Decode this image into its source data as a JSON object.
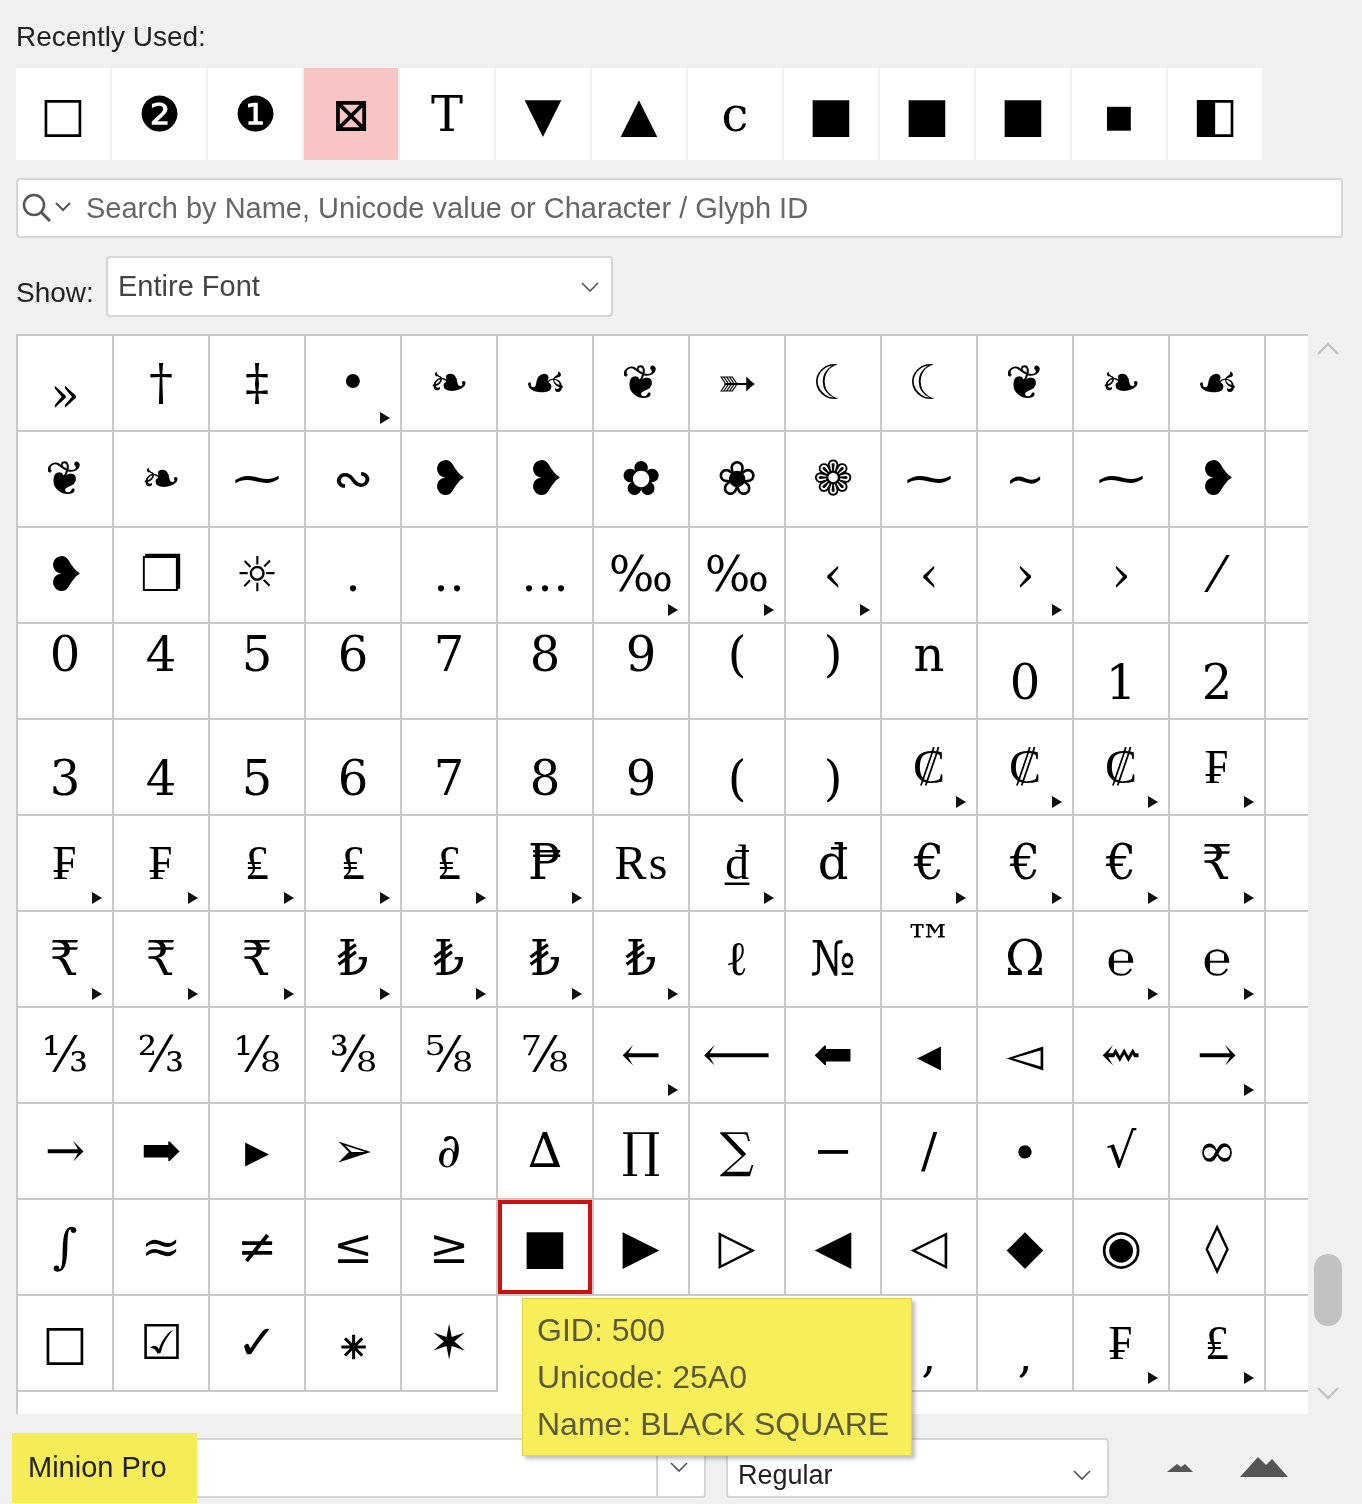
{
  "recent": {
    "label": "Recently Used:",
    "glyphs": [
      {
        "glyph": "□",
        "selected": false
      },
      {
        "glyph": "❷",
        "selected": false
      },
      {
        "glyph": "❶",
        "selected": false
      },
      {
        "glyph": "⊠",
        "selected": true
      },
      {
        "glyph": "T",
        "selected": false
      },
      {
        "glyph": "▼",
        "selected": false
      },
      {
        "glyph": "▲",
        "selected": false
      },
      {
        "glyph": "c",
        "selected": false
      },
      {
        "glyph": "■",
        "selected": false
      },
      {
        "glyph": "■",
        "selected": false
      },
      {
        "glyph": "■",
        "selected": false
      },
      {
        "glyph": "▪",
        "selected": false
      },
      {
        "glyph": "◧",
        "selected": false
      }
    ]
  },
  "search": {
    "placeholder": "Search by Name, Unicode value or Character / Glyph ID"
  },
  "show": {
    "label": "Show:",
    "value": "Entire Font"
  },
  "grid": [
    [
      {
        "kind": "inferior",
        "glyph": "»",
        "alternates": false
      },
      {
        "kind": "glyph",
        "glyph": "†",
        "alternates": false
      },
      {
        "kind": "glyph",
        "glyph": "‡",
        "alternates": false
      },
      {
        "kind": "glyph",
        "glyph": "•",
        "alternates": true
      },
      {
        "kind": "glyph",
        "glyph": "❧",
        "alternates": false
      },
      {
        "kind": "glyph",
        "glyph": "☙",
        "alternates": false
      },
      {
        "kind": "glyph",
        "glyph": "❦",
        "alternates": false
      },
      {
        "kind": "glyph",
        "glyph": "➳",
        "alternates": false
      },
      {
        "kind": "glyph",
        "glyph": "☾",
        "alternates": false
      },
      {
        "kind": "glyph",
        "glyph": "☾",
        "alternates": false
      },
      {
        "kind": "glyph",
        "glyph": "❦",
        "alternates": false
      },
      {
        "kind": "glyph",
        "glyph": "❧",
        "alternates": false
      },
      {
        "kind": "glyph",
        "glyph": "☙",
        "alternates": false
      }
    ],
    [
      {
        "kind": "glyph",
        "glyph": "❦",
        "alternates": false
      },
      {
        "kind": "glyph",
        "glyph": "❧",
        "alternates": false
      },
      {
        "kind": "glyph",
        "glyph": "⁓",
        "alternates": false
      },
      {
        "kind": "glyph",
        "glyph": "∾",
        "alternates": false
      },
      {
        "kind": "glyph",
        "glyph": "❥",
        "alternates": false
      },
      {
        "kind": "glyph",
        "glyph": "❥",
        "alternates": false
      },
      {
        "kind": "glyph",
        "glyph": "✿",
        "alternates": false
      },
      {
        "kind": "glyph",
        "glyph": "❀",
        "alternates": false
      },
      {
        "kind": "glyph",
        "glyph": "❁",
        "alternates": false
      },
      {
        "kind": "glyph",
        "glyph": "⁓",
        "alternates": false
      },
      {
        "kind": "glyph",
        "glyph": "∼",
        "alternates": false
      },
      {
        "kind": "glyph",
        "glyph": "⁓",
        "alternates": false
      },
      {
        "kind": "glyph",
        "glyph": "❥",
        "alternates": false
      }
    ],
    [
      {
        "kind": "glyph",
        "glyph": "❥",
        "alternates": false
      },
      {
        "kind": "glyph",
        "glyph": "❐",
        "alternates": false
      },
      {
        "kind": "glyph",
        "glyph": "☼",
        "alternates": false
      },
      {
        "kind": "glyph",
        "glyph": "․",
        "alternates": false
      },
      {
        "kind": "glyph",
        "glyph": "‥",
        "alternates": false
      },
      {
        "kind": "glyph",
        "glyph": "…",
        "alternates": false
      },
      {
        "kind": "glyph",
        "glyph": "‰",
        "alternates": true
      },
      {
        "kind": "glyph",
        "glyph": "‰",
        "alternates": true
      },
      {
        "kind": "glyph",
        "glyph": "‹",
        "alternates": true
      },
      {
        "kind": "glyph",
        "glyph": "‹",
        "alternates": false
      },
      {
        "kind": "glyph",
        "glyph": "›",
        "alternates": true
      },
      {
        "kind": "glyph",
        "glyph": "›",
        "alternates": false
      },
      {
        "kind": "glyph",
        "glyph": "⁄",
        "alternates": false
      }
    ],
    [
      {
        "kind": "superior",
        "glyph": "0",
        "alternates": false
      },
      {
        "kind": "superior",
        "glyph": "4",
        "alternates": false
      },
      {
        "kind": "superior",
        "glyph": "5",
        "alternates": false
      },
      {
        "kind": "superior",
        "glyph": "6",
        "alternates": false
      },
      {
        "kind": "superior",
        "glyph": "7",
        "alternates": false
      },
      {
        "kind": "superior",
        "glyph": "8",
        "alternates": false
      },
      {
        "kind": "superior",
        "glyph": "9",
        "alternates": false
      },
      {
        "kind": "superior",
        "glyph": "(",
        "alternates": false
      },
      {
        "kind": "superior",
        "glyph": ")",
        "alternates": false
      },
      {
        "kind": "superior",
        "glyph": "n",
        "alternates": false
      },
      {
        "kind": "inferior",
        "glyph": "0",
        "alternates": false
      },
      {
        "kind": "inferior",
        "glyph": "1",
        "alternates": false
      },
      {
        "kind": "inferior",
        "glyph": "2",
        "alternates": false
      }
    ],
    [
      {
        "kind": "inferior",
        "glyph": "3",
        "alternates": false
      },
      {
        "kind": "inferior",
        "glyph": "4",
        "alternates": false
      },
      {
        "kind": "inferior",
        "glyph": "5",
        "alternates": false
      },
      {
        "kind": "inferior",
        "glyph": "6",
        "alternates": false
      },
      {
        "kind": "inferior",
        "glyph": "7",
        "alternates": false
      },
      {
        "kind": "inferior",
        "glyph": "8",
        "alternates": false
      },
      {
        "kind": "inferior",
        "glyph": "9",
        "alternates": false
      },
      {
        "kind": "inferior",
        "glyph": "(",
        "alternates": false
      },
      {
        "kind": "inferior",
        "glyph": ")",
        "alternates": false
      },
      {
        "kind": "glyph",
        "glyph": "₡",
        "alternates": true
      },
      {
        "kind": "glyph",
        "glyph": "₡",
        "alternates": true
      },
      {
        "kind": "glyph",
        "glyph": "₡",
        "alternates": true
      },
      {
        "kind": "glyph",
        "glyph": "₣",
        "alternates": true
      }
    ],
    [
      {
        "kind": "glyph",
        "glyph": "₣",
        "alternates": true
      },
      {
        "kind": "glyph",
        "glyph": "₣",
        "alternates": true
      },
      {
        "kind": "glyph",
        "glyph": "₤",
        "alternates": true
      },
      {
        "kind": "glyph",
        "glyph": "₤",
        "alternates": true
      },
      {
        "kind": "glyph",
        "glyph": "₤",
        "alternates": true
      },
      {
        "kind": "glyph",
        "glyph": "₱",
        "alternates": true
      },
      {
        "kind": "glyph",
        "glyph": "₨",
        "alternates": false
      },
      {
        "kind": "glyph",
        "glyph": "₫",
        "alternates": true
      },
      {
        "kind": "glyph",
        "glyph": "đ",
        "alternates": false
      },
      {
        "kind": "glyph",
        "glyph": "€",
        "alternates": true
      },
      {
        "kind": "glyph",
        "glyph": "€",
        "alternates": true
      },
      {
        "kind": "glyph",
        "glyph": "€",
        "alternates": true
      },
      {
        "kind": "glyph",
        "glyph": "₹",
        "alternates": true
      }
    ],
    [
      {
        "kind": "glyph",
        "glyph": "₹",
        "alternates": true
      },
      {
        "kind": "glyph",
        "glyph": "₹",
        "alternates": true
      },
      {
        "kind": "glyph",
        "glyph": "₹",
        "alternates": true
      },
      {
        "kind": "glyph",
        "glyph": "₺",
        "alternates": true
      },
      {
        "kind": "glyph",
        "glyph": "₺",
        "alternates": true
      },
      {
        "kind": "glyph",
        "glyph": "₺",
        "alternates": true
      },
      {
        "kind": "glyph",
        "glyph": "₺",
        "alternates": true
      },
      {
        "kind": "glyph",
        "glyph": "ℓ",
        "alternates": false
      },
      {
        "kind": "glyph",
        "glyph": "№",
        "alternates": false
      },
      {
        "kind": "superior",
        "glyph": "™",
        "alternates": false
      },
      {
        "kind": "glyph",
        "glyph": "Ω",
        "alternates": false
      },
      {
        "kind": "glyph",
        "glyph": "℮",
        "alternates": true
      },
      {
        "kind": "glyph",
        "glyph": "℮",
        "alternates": true
      }
    ],
    [
      {
        "kind": "glyph",
        "glyph": "⅓",
        "alternates": false
      },
      {
        "kind": "glyph",
        "glyph": "⅔",
        "alternates": false
      },
      {
        "kind": "glyph",
        "glyph": "⅛",
        "alternates": false
      },
      {
        "kind": "glyph",
        "glyph": "⅜",
        "alternates": false
      },
      {
        "kind": "glyph",
        "glyph": "⅝",
        "alternates": false
      },
      {
        "kind": "glyph",
        "glyph": "⅞",
        "alternates": false
      },
      {
        "kind": "glyph",
        "glyph": "←",
        "alternates": true
      },
      {
        "kind": "glyph",
        "glyph": "⟵",
        "alternates": false
      },
      {
        "kind": "glyph",
        "glyph": "⬅",
        "alternates": false
      },
      {
        "kind": "glyph",
        "glyph": "◂",
        "alternates": false
      },
      {
        "kind": "glyph",
        "glyph": "◅",
        "alternates": false
      },
      {
        "kind": "glyph",
        "glyph": "⇜",
        "alternates": false
      },
      {
        "kind": "glyph",
        "glyph": "→",
        "alternates": true
      }
    ],
    [
      {
        "kind": "glyph",
        "glyph": "→",
        "alternates": false
      },
      {
        "kind": "glyph",
        "glyph": "➡",
        "alternates": false
      },
      {
        "kind": "glyph",
        "glyph": "▸",
        "alternates": false
      },
      {
        "kind": "glyph",
        "glyph": "➢",
        "alternates": false
      },
      {
        "kind": "glyph",
        "glyph": "∂",
        "alternates": false
      },
      {
        "kind": "glyph",
        "glyph": "∆",
        "alternates": false
      },
      {
        "kind": "glyph",
        "glyph": "∏",
        "alternates": false
      },
      {
        "kind": "glyph",
        "glyph": "∑",
        "alternates": false
      },
      {
        "kind": "glyph",
        "glyph": "−",
        "alternates": false
      },
      {
        "kind": "glyph",
        "glyph": "∕",
        "alternates": false
      },
      {
        "kind": "glyph",
        "glyph": "∙",
        "alternates": false
      },
      {
        "kind": "glyph",
        "glyph": "√",
        "alternates": false
      },
      {
        "kind": "glyph",
        "glyph": "∞",
        "alternates": false
      }
    ],
    [
      {
        "kind": "glyph",
        "glyph": "∫",
        "alternates": false,
        "selected": false
      },
      {
        "kind": "glyph",
        "glyph": "≈",
        "alternates": false,
        "selected": false
      },
      {
        "kind": "glyph",
        "glyph": "≠",
        "alternates": false,
        "selected": false
      },
      {
        "kind": "glyph",
        "glyph": "≤",
        "alternates": false,
        "selected": false
      },
      {
        "kind": "glyph",
        "glyph": "≥",
        "alternates": false,
        "selected": false
      },
      {
        "kind": "glyph",
        "glyph": "■",
        "alternates": false,
        "selected": true
      },
      {
        "kind": "glyph",
        "glyph": "▶",
        "alternates": false,
        "selected": false
      },
      {
        "kind": "glyph",
        "glyph": "▷",
        "alternates": false,
        "selected": false
      },
      {
        "kind": "glyph",
        "glyph": "◀",
        "alternates": false,
        "selected": false
      },
      {
        "kind": "glyph",
        "glyph": "◁",
        "alternates": false,
        "selected": false
      },
      {
        "kind": "glyph",
        "glyph": "◆",
        "alternates": false,
        "selected": false
      },
      {
        "kind": "glyph",
        "glyph": "◉",
        "alternates": false,
        "selected": false
      },
      {
        "kind": "glyph",
        "glyph": "◊",
        "alternates": false,
        "selected": false
      }
    ],
    [
      {
        "kind": "glyph",
        "glyph": "□",
        "alternates": false
      },
      {
        "kind": "glyph",
        "glyph": "☑",
        "alternates": false
      },
      {
        "kind": "glyph",
        "glyph": "✓",
        "alternates": false
      },
      {
        "kind": "glyph",
        "glyph": "⁕",
        "alternates": false
      },
      {
        "kind": "glyph",
        "glyph": "✶",
        "alternates": false
      },
      {
        "kind": "covered"
      },
      {
        "kind": "covered"
      },
      {
        "kind": "covered"
      },
      {
        "kind": "covered"
      },
      {
        "kind": "inferior",
        "glyph": ",",
        "alternates": false
      },
      {
        "kind": "inferior",
        "glyph": "‚",
        "alternates": false
      },
      {
        "kind": "glyph",
        "glyph": "₣",
        "alternates": true
      },
      {
        "kind": "glyph",
        "glyph": "₤",
        "alternates": true
      }
    ]
  ],
  "tooltip": [
    "GID: 500",
    "Unicode: 25A0",
    "Name: BLACK SQUARE"
  ],
  "font": {
    "value": "Minion Pro",
    "highlighted": true
  },
  "style": {
    "value": "Regular"
  }
}
